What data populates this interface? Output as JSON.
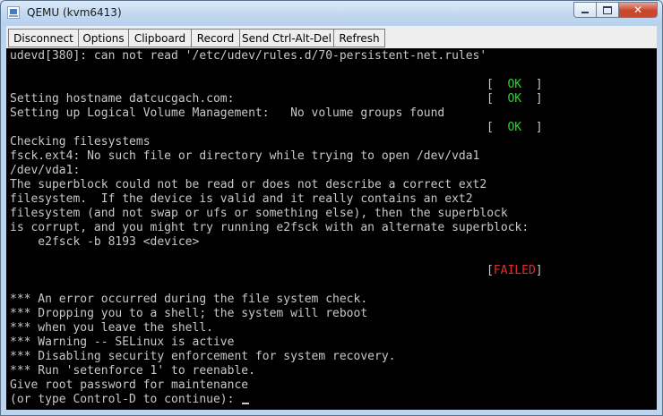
{
  "window": {
    "title": "QEMU (kvm6413)",
    "close_glyph": "✕"
  },
  "toolbar": {
    "disconnect": "Disconnect",
    "options": "Options",
    "clipboard": "Clipboard",
    "record": "Record",
    "send_cad": "Send Ctrl-Alt-Del",
    "refresh": "Refresh"
  },
  "console": {
    "lines": {
      "l01": "udevd[380]: can not read '/etc/udev/rules.d/70-persistent-net.rules'",
      "l04": "Setting hostname datcucgach.com:",
      "l05": "Setting up Logical Volume Management:   No volume groups found",
      "l07": "Checking filesystems",
      "l08": "fsck.ext4: No such file or directory while trying to open /dev/vda1",
      "l09": "/dev/vda1:",
      "l10": "The superblock could not be read or does not describe a correct ext2",
      "l11": "filesystem.  If the device is valid and it really contains an ext2",
      "l12": "filesystem (and not swap or ufs or something else), then the superblock",
      "l13": "is corrupt, and you might try running e2fsck with an alternate superblock:",
      "l14": "    e2fsck -b 8193 <device>",
      "l18": "*** An error occurred during the file system check.",
      "l19": "*** Dropping you to a shell; the system will reboot",
      "l20": "*** when you leave the shell.",
      "l21": "*** Warning -- SELinux is active",
      "l22": "*** Disabling security enforcement for system recovery.",
      "l23": "*** Run 'setenforce 1' to reenable.",
      "l24": "Give root password for maintenance",
      "l25": "(or type Control-D to continue): "
    },
    "status": {
      "open": "[  ",
      "close": "  ]",
      "ok": "OK",
      "fail_open": "[",
      "fail_close": "]",
      "failed": "FAILED"
    }
  }
}
